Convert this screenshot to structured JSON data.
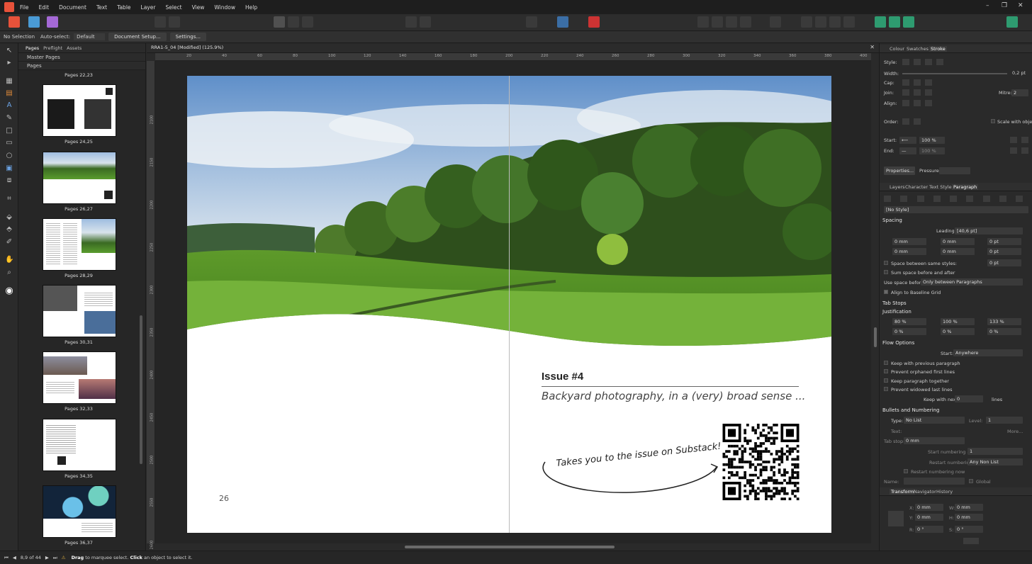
{
  "menu": [
    "File",
    "Edit",
    "Document",
    "Text",
    "Table",
    "Layer",
    "Select",
    "View",
    "Window",
    "Help"
  ],
  "context_bar": {
    "selection": "No Selection",
    "autoselect_label": "Auto-select:",
    "autoselect_value": "Default",
    "doc_setup": "Document Setup...",
    "settings": "Settings..."
  },
  "pages_panel": {
    "tabs": [
      "Pages",
      "Preflight",
      "Assets"
    ],
    "master_pages": "Master Pages",
    "pages": "Pages",
    "top_label": "Pages 22,23",
    "thumbs": [
      "Pages 24,25",
      "Pages 26,27",
      "Pages 28,29",
      "Pages 30,31",
      "Pages 32,33",
      "Pages 34,35",
      "Pages 36,37"
    ]
  },
  "document": {
    "tab_title": "RRA1-5_04 [Modified] (125.9%)",
    "ruler_h": [
      "20",
      "40",
      "60",
      "80",
      "100",
      "120",
      "140",
      "160",
      "180",
      "200",
      "220",
      "240",
      "260",
      "280",
      "300",
      "320",
      "340",
      "360",
      "380",
      "400"
    ],
    "ruler_v": [
      "2100",
      "2150",
      "2200",
      "2250",
      "2300",
      "2350",
      "2400",
      "2450",
      "2500",
      "2550",
      "2600"
    ],
    "issue_title": "Issue #4",
    "issue_subtitle": "Backyard photography, in a (very) broad sense ...",
    "handwritten_note": "Takes you to the issue on Substack!",
    "page_number": "26"
  },
  "right_panel": {
    "stroke_tabs": [
      "Colour",
      "Swatches",
      "Stroke"
    ],
    "style": "Style:",
    "width": "Width:",
    "width_value": "0,2 pt",
    "cap": "Cap:",
    "join": "Join:",
    "mitre": "Mitre:",
    "mitre_value": "2",
    "align": "Align:",
    "order": "Order:",
    "scale_with_object": "Scale with object",
    "start": "Start:",
    "start_pct": "100 %",
    "end": "End:",
    "end_pct": "100 %",
    "properties": "Properties...",
    "pressure": "Pressure:",
    "para_tabs": [
      "Layers",
      "Character",
      "Text Styles",
      "Paragraph"
    ],
    "no_style": "[No Style]",
    "spacing": "Spacing",
    "leading": "Leading:",
    "leading_value": "[40,6 pt]",
    "indent": [
      "0 mm",
      "0 mm",
      "0 pt",
      "0 mm",
      "0 mm",
      "0 pt"
    ],
    "space_same": "Space between same styles:",
    "space_same_val": "0 pt",
    "sum_space": "Sum space before and after",
    "use_space_before": "Use space before:",
    "use_space_value": "Only between Paragraphs",
    "align_baseline": "Align to Baseline Grid",
    "tab_stops": "Tab Stops",
    "justification": "Justification",
    "just_vals": [
      "80 %",
      "100 %",
      "133 %",
      "0 %",
      "0 %",
      "0 %"
    ],
    "flow_options": "Flow Options",
    "start_flow": "Start:",
    "start_flow_val": "Anywhere",
    "flow_checks": [
      "Keep with previous paragraph",
      "Prevent orphaned first lines",
      "Keep paragraph together",
      "Prevent widowed last lines"
    ],
    "keep_next": "Keep with next:",
    "keep_next_val": "0",
    "lines": "lines",
    "bullets": "Bullets and Numbering",
    "type": "Type:",
    "type_val": "No List",
    "level": "Level:",
    "level_val": "1",
    "text": "Text:",
    "more": "More...",
    "tab_stop": "Tab stop:",
    "tab_stop_val": "0 mm",
    "start_numbering": "Start numbering at:",
    "start_numbering_val": "1",
    "restart_numbering": "Restart numbering:",
    "restart_val": "Any Non List",
    "restart_now": "Restart numbering now",
    "name": "Name:",
    "global": "Global",
    "transform_tabs": [
      "Transform",
      "Navigator",
      "History"
    ],
    "tx": [
      "X:",
      "0 mm",
      "W:",
      "0 mm",
      "Y:",
      "0 mm",
      "H:",
      "0 mm",
      "R:",
      "0 °",
      "S:",
      "0 °"
    ]
  },
  "status": {
    "page_of": "8,9 of 44",
    "drag": "Drag",
    "drag_rest": " to marquee select. ",
    "click": "Click",
    "click_rest": " an object to select it."
  }
}
